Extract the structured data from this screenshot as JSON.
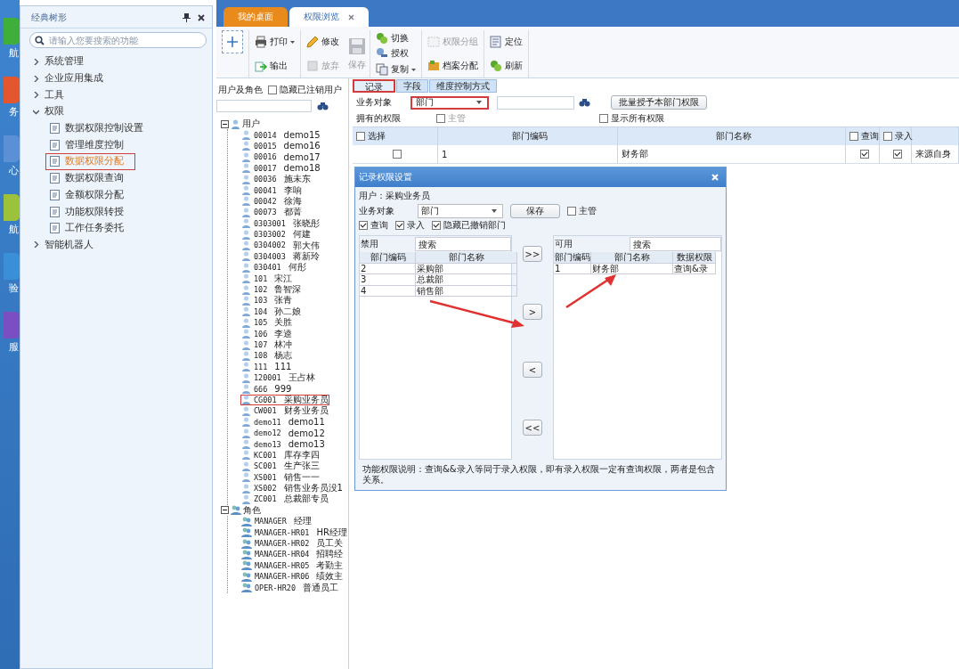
{
  "rail": [
    {
      "label": "航",
      "color": "#3fae3a"
    },
    {
      "label": "务",
      "color": "#e4572e"
    },
    {
      "label": "心",
      "color": "#5b8fd6"
    },
    {
      "label": "航",
      "color": "#9bc23a"
    },
    {
      "label": "验",
      "color": "#3a8fd6"
    },
    {
      "label": "服",
      "color": "#7a4fc2"
    }
  ],
  "sidebar": {
    "title": "经典树形",
    "search_placeholder": "请输入您要搜索的功能",
    "items": [
      {
        "label": "系统管理",
        "expanded": false
      },
      {
        "label": "企业应用集成",
        "expanded": false
      },
      {
        "label": "工具",
        "expanded": false
      },
      {
        "label": "权限",
        "expanded": true,
        "children": [
          {
            "label": "数据权限控制设置",
            "selected": false
          },
          {
            "label": "管理维度控制",
            "selected": false
          },
          {
            "label": "数据权限分配",
            "selected": true
          },
          {
            "label": "数据权限查询",
            "selected": false
          },
          {
            "label": "金额权限分配",
            "selected": false
          },
          {
            "label": "功能权限转授",
            "selected": false
          },
          {
            "label": "工作任务委托",
            "selected": false
          }
        ]
      },
      {
        "label": "智能机器人",
        "expanded": false
      }
    ]
  },
  "tabs": [
    {
      "label": "我的桌面",
      "selected": false,
      "closable": false
    },
    {
      "label": "权限浏览",
      "selected": true,
      "closable": true
    }
  ],
  "toolbar": [
    {
      "kind": "add"
    },
    {
      "kind": "stack",
      "items": [
        {
          "label": "打印",
          "disabled": false,
          "dropdown": true
        },
        {
          "label": "输出",
          "disabled": false,
          "dropdown": false
        }
      ]
    },
    {
      "kind": "stack",
      "items": [
        {
          "label": "修改",
          "disabled": false,
          "dropdown": false
        },
        {
          "label": "放弃",
          "disabled": true,
          "dropdown": false
        }
      ]
    },
    {
      "kind": "large",
      "label": "保存",
      "disabled": true
    },
    {
      "kind": "stack",
      "items": [
        {
          "label": "切换",
          "disabled": false,
          "dropdown": false
        },
        {
          "label": "授权",
          "disabled": false,
          "dropdown": false
        },
        {
          "label": "复制",
          "disabled": false,
          "dropdown": true
        }
      ]
    },
    {
      "kind": "stack",
      "items": [
        {
          "label": "权限分组",
          "disabled": true,
          "dropdown": false
        },
        {
          "label": "档案分配",
          "disabled": false,
          "dropdown": false
        }
      ]
    },
    {
      "kind": "stack",
      "items": [
        {
          "label": "定位",
          "disabled": false,
          "dropdown": false
        },
        {
          "label": "刷新",
          "disabled": false,
          "dropdown": false
        }
      ]
    }
  ],
  "user_pane": {
    "title": "用户及角色",
    "hide_cancelled": {
      "label": "隐藏已注销用户",
      "checked": false
    },
    "users": {
      "label": "用户",
      "expanded": true,
      "children": [
        {
          "code": "00014",
          "name": "demo15",
          "selected": false
        },
        {
          "code": "00015",
          "name": "demo16",
          "selected": false
        },
        {
          "code": "00016",
          "name": "demo17",
          "selected": false
        },
        {
          "code": "00017",
          "name": "demo18",
          "selected": false
        },
        {
          "code": "00036",
          "name": "施未东",
          "selected": false
        },
        {
          "code": "00041",
          "name": "李响",
          "selected": false
        },
        {
          "code": "00042",
          "name": "徐海",
          "selected": false
        },
        {
          "code": "00073",
          "name": "都菁",
          "selected": false
        },
        {
          "code": "0303001",
          "name": "张晓彤",
          "selected": false
        },
        {
          "code": "0303002",
          "name": "何建",
          "selected": false
        },
        {
          "code": "0304002",
          "name": "郭大伟",
          "selected": false
        },
        {
          "code": "0304003",
          "name": "蒋新玲",
          "selected": false
        },
        {
          "code": "030401",
          "name": "何彤",
          "selected": false
        },
        {
          "code": "101",
          "name": "宋江",
          "selected": false
        },
        {
          "code": "102",
          "name": "鲁智深",
          "selected": false
        },
        {
          "code": "103",
          "name": "张青",
          "selected": false
        },
        {
          "code": "104",
          "name": "孙二娘",
          "selected": false
        },
        {
          "code": "105",
          "name": "关胜",
          "selected": false
        },
        {
          "code": "106",
          "name": "李逵",
          "selected": false
        },
        {
          "code": "107",
          "name": "林冲",
          "selected": false
        },
        {
          "code": "108",
          "name": "杨志",
          "selected": false
        },
        {
          "code": "111",
          "name": "111",
          "selected": false
        },
        {
          "code": "120001",
          "name": "王占林",
          "selected": false
        },
        {
          "code": "666",
          "name": "999",
          "selected": false
        },
        {
          "code": "CG001",
          "name": "采购业务员",
          "selected": true
        },
        {
          "code": "CW001",
          "name": "财务业务员",
          "selected": false
        },
        {
          "code": "demo11",
          "name": "demo11",
          "selected": false
        },
        {
          "code": "demo12",
          "name": "demo12",
          "selected": false
        },
        {
          "code": "demo13",
          "name": "demo13",
          "selected": false
        },
        {
          "code": "KC001",
          "name": "库存李四",
          "selected": false
        },
        {
          "code": "SC001",
          "name": "生产张三",
          "selected": false
        },
        {
          "code": "XS001",
          "name": "销售一一",
          "selected": false
        },
        {
          "code": "XS002",
          "name": "销售业务员没1",
          "selected": false
        },
        {
          "code": "ZC001",
          "name": "总裁部专员",
          "selected": false
        }
      ]
    },
    "roles": {
      "label": "角色",
      "expanded": true,
      "children": [
        {
          "code": "MANAGER",
          "name": "经理"
        },
        {
          "code": "MANAGER-HR01",
          "name": "HR经理"
        },
        {
          "code": "MANAGER-HR02",
          "name": "员工关"
        },
        {
          "code": "MANAGER-HR04",
          "name": "招聘经"
        },
        {
          "code": "MANAGER-HR05",
          "name": "考勤主"
        },
        {
          "code": "MANAGER-HR06",
          "name": "绩效主"
        },
        {
          "code": "OPER-HR20",
          "name": "普通员工"
        }
      ]
    }
  },
  "record_pane": {
    "tabs": [
      {
        "label": "记录",
        "selected": true
      },
      {
        "label": "字段",
        "selected": false
      },
      {
        "label": "维度控制方式",
        "selected": false
      }
    ],
    "object_label": "业务对象",
    "object_value": "部门",
    "object_highlighted": true,
    "batch_button": "批量授予本部门权限",
    "owned_label": "拥有的权限",
    "supervisor": {
      "label": "主管",
      "checked": false,
      "disabled": true
    },
    "show_all": {
      "label": "显示所有权限",
      "checked": false
    },
    "columns": [
      {
        "label": "选择",
        "checked": false
      },
      {
        "label": "部门编码"
      },
      {
        "label": "部门名称"
      },
      {
        "label": "查询",
        "checked": false
      },
      {
        "label": "录入",
        "checked": false
      }
    ],
    "rows": [
      {
        "selected": false,
        "code": "1",
        "name": "财务部",
        "query": true,
        "entry": true,
        "source": "来源自身"
      }
    ]
  },
  "dialog": {
    "title": "记录权限设置",
    "user_label": "用户：采购业务员",
    "object_label": "业务对象",
    "object_value": "部门",
    "save": "保存",
    "supervisor": {
      "label": "主管",
      "checked": false
    },
    "options": [
      {
        "label": "查询",
        "checked": true
      },
      {
        "label": "录入",
        "checked": true
      },
      {
        "label": "隐藏已撤销部门",
        "checked": true
      }
    ],
    "denied": {
      "label": "禁用",
      "search_placeholder": "搜索",
      "columns": [
        "部门编码",
        "部门名称"
      ],
      "rows": [
        [
          "2",
          "采购部"
        ],
        [
          "3",
          "总裁部"
        ],
        [
          "4",
          "销售部"
        ]
      ]
    },
    "move_buttons": [
      ">>",
      ">",
      "<",
      "<<"
    ],
    "allowed": {
      "label": "可用",
      "search_placeholder": "搜索",
      "columns": [
        "部门编码",
        "部门名称",
        "数据权限"
      ],
      "rows": [
        [
          "1",
          "财务部",
          "查询&录"
        ]
      ]
    },
    "note": "功能权限说明：查询&&录入等同于录入权限，即有录入权限一定有查询权限，两者是包含关系。"
  }
}
